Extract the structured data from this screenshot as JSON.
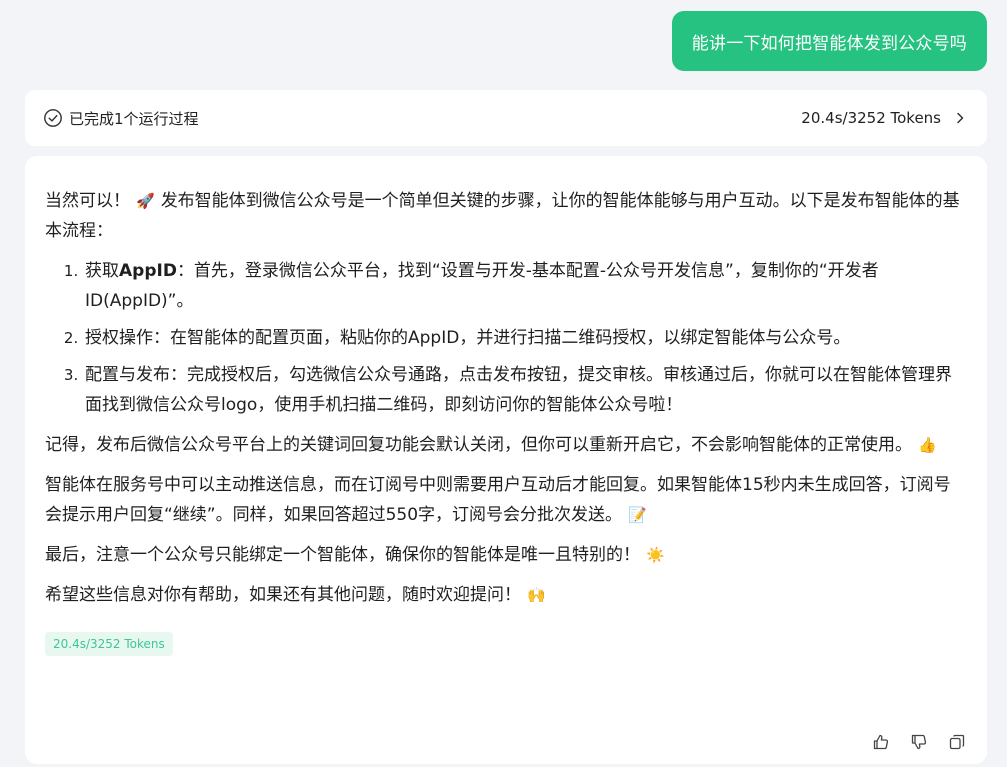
{
  "user_message": "能讲一下如何把智能体发到公众号吗",
  "process": {
    "status": "已完成1个运行过程",
    "stats": "20.4s/3252 Tokens"
  },
  "answer": {
    "intro": "当然可以！",
    "intro_rest": "发布智能体到微信公众号是一个简单但关键的步骤，让你的智能体能够与用户互动。以下是发布智能体的基本流程：",
    "steps": [
      {
        "prefix": "获取",
        "bold": "AppID",
        "text": "：首先，登录微信公众平台，找到“设置与开发-基本配置-公众号开发信息”，复制你的“开发者ID(AppID)”。"
      },
      {
        "prefix": "",
        "bold": "",
        "text": "授权操作：在智能体的配置页面，粘贴你的AppID，并进行扫描二维码授权，以绑定智能体与公众号。"
      },
      {
        "prefix": "",
        "bold": "",
        "text": "配置与发布：完成授权后，勾选微信公众号通路，点击发布按钮，提交审核。审核通过后，你就可以在智能体管理界面找到微信公众号logo，使用手机扫描二维码，即刻访问你的智能体公众号啦！"
      }
    ],
    "para1": "记得，发布后微信公众号平台上的关键词回复功能会默认关闭，但你可以重新开启它，不会影响智能体的正常使用。",
    "para2": "智能体在服务号中可以主动推送信息，而在订阅号中则需要用户互动后才能回复。如果智能体15秒内未生成回答，订阅号会提示用户回复“继续”。同样，如果回答超过550字，订阅号会分批次发送。",
    "para3": "最后，注意一个公众号只能绑定一个智能体，确保你的智能体是唯一且特别的！",
    "para4": "希望这些信息对你有帮助，如果还有其他问题，随时欢迎提问！",
    "emojis": {
      "rocket": "🚀",
      "thumb": "👍",
      "memo": "📝",
      "sun": "☀️",
      "hands": "🙌"
    },
    "token_badge": "20.4s/3252 Tokens"
  },
  "colors": {
    "accent": "#26c281",
    "badge_bg": "#e8f8f1",
    "badge_text": "#3cc893"
  }
}
